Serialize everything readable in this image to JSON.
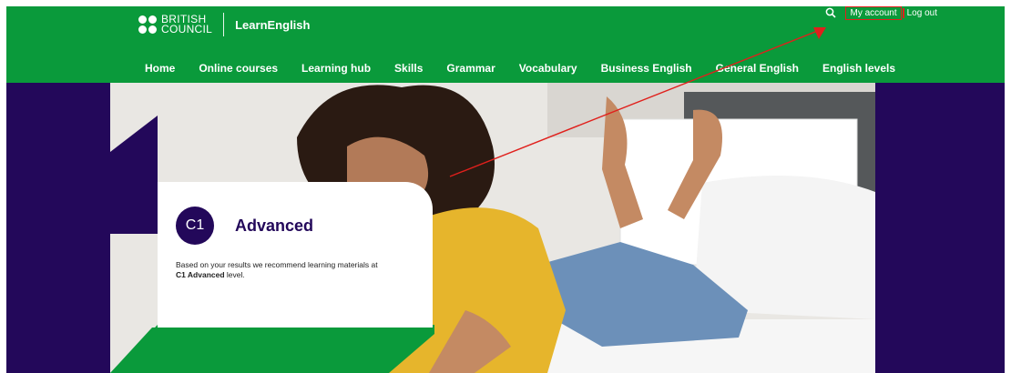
{
  "brand": {
    "line1": "BRITISH",
    "line2": "COUNCIL",
    "product": "LearnEnglish"
  },
  "util": {
    "account_label": "My account",
    "logout_label": "Log out"
  },
  "nav": {
    "items": [
      {
        "label": "Home"
      },
      {
        "label": "Online courses"
      },
      {
        "label": "Learning hub"
      },
      {
        "label": "Skills"
      },
      {
        "label": "Grammar"
      },
      {
        "label": "Vocabulary"
      },
      {
        "label": "Business English"
      },
      {
        "label": "General English"
      },
      {
        "label": "English levels"
      }
    ]
  },
  "result": {
    "badge": "C1",
    "level_name": "Advanced",
    "desc_before": "Based on your results we recommend learning materials at ",
    "desc_bold": "C1 Advanced",
    "desc_after": " level."
  },
  "colors": {
    "brand_green": "#0a9a3b",
    "brand_purple": "#23085a",
    "annotation_red": "#e0201c",
    "sweater_yellow": "#e6b52c"
  }
}
